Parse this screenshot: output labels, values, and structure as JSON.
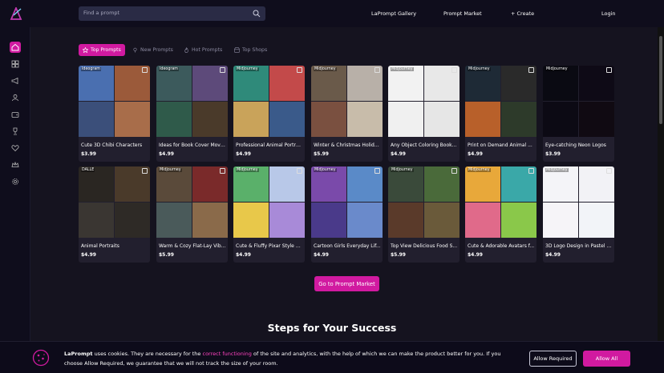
{
  "header": {
    "search_placeholder": "Find a prompt",
    "nav": [
      "LaPrompt Gallery",
      "Prompt Market",
      "+ Create"
    ],
    "login": "Login"
  },
  "sidebar": {
    "items": [
      "home-icon",
      "grid-icon",
      "megaphone-icon",
      "user-icon",
      "wallet-icon",
      "trophy-icon",
      "heart-icon",
      "crown-icon",
      "gear-icon"
    ],
    "active": "home-icon"
  },
  "tabs": [
    {
      "label": "Top Prompts",
      "icon": "star-icon",
      "active": true
    },
    {
      "label": "New Prompts",
      "icon": "pin-icon",
      "active": false
    },
    {
      "label": "Hot Prompts",
      "icon": "flame-icon",
      "active": false
    },
    {
      "label": "Top Shops",
      "icon": "shop-icon",
      "active": false
    }
  ],
  "cards": [
    {
      "badge": "Ideogram",
      "title": "Cute 3D Chibi Characters",
      "price": "$3.99",
      "colors": [
        "#4a6fb0",
        "#9b5a3a",
        "#3b4f7a",
        "#a86d4a"
      ]
    },
    {
      "badge": "Ideogram",
      "title": "Ideas for Book Cover Movi...",
      "price": "$4.99",
      "colors": [
        "#3c5a5c",
        "#5d4a7a",
        "#2f5a4a",
        "#4a3a2a"
      ]
    },
    {
      "badge": "Midjourney",
      "title": "Professional Animal Portra...",
      "price": "$4.99",
      "colors": [
        "#2f8a7a",
        "#c34a4a",
        "#c9a35a",
        "#3a5a8a"
      ]
    },
    {
      "badge": "Midjourney",
      "title": "Winter & Christmas Holida...",
      "price": "$5.99",
      "colors": [
        "#6a5a4a",
        "#b8b0a8",
        "#7a5040",
        "#c8bcaa"
      ]
    },
    {
      "badge": "Midjourney",
      "title": "Any Object Coloring Book ...",
      "price": "$4.99",
      "colors": [
        "#f2f2f2",
        "#e8e8e8",
        "#f0f0f0",
        "#e6e6e6"
      ]
    },
    {
      "badge": "Midjourney",
      "title": "Print on Demand Animal ...",
      "price": "$4.99",
      "colors": [
        "#1e2a36",
        "#2a2a2a",
        "#b8602a",
        "#2d3a2a"
      ]
    },
    {
      "badge": "Midjourney",
      "title": "Eye-catching Neon Logos",
      "price": "$3.99",
      "colors": [
        "#0a0a12",
        "#0e0a16",
        "#0c0a14",
        "#100a12"
      ]
    },
    {
      "badge": "DALLE",
      "title": "Animal Portraits",
      "price": "$4.99",
      "colors": [
        "#2a2622",
        "#4a3a2a",
        "#3a3632",
        "#2e2a26"
      ]
    },
    {
      "badge": "Midjourney",
      "title": "Warm & Cozy Flat-Lay Vib...",
      "price": "$5.99",
      "colors": [
        "#5a4a3a",
        "#7a2a2a",
        "#4a5a5a",
        "#8a6a4a"
      ]
    },
    {
      "badge": "Midjourney",
      "title": "Cute & Fluffy Pixar Style A...",
      "price": "$4.99",
      "colors": [
        "#5ab06a",
        "#b8c8e8",
        "#e8c84a",
        "#a88ad8"
      ]
    },
    {
      "badge": "Midjourney",
      "title": "Cartoon Girls Everyday Lif...",
      "price": "$4.99",
      "colors": [
        "#7a4aaa",
        "#5a8ac8",
        "#4a3a8a",
        "#6a8acb"
      ]
    },
    {
      "badge": "Midjourney",
      "title": "Top View Delicious Food S...",
      "price": "$5.99",
      "colors": [
        "#3a4a3a",
        "#4a6a3a",
        "#5a3a2a",
        "#6a5a3a"
      ]
    },
    {
      "badge": "Midjourney",
      "title": "Cute & Adorable Avatars f...",
      "price": "$4.99",
      "colors": [
        "#e8a83a",
        "#3aa8a8",
        "#e06a8a",
        "#8ac84a"
      ]
    },
    {
      "badge": "Midjourney",
      "title": "3D Logo Design in Pastel C...",
      "price": "$4.99",
      "colors": [
        "#f4f4f8",
        "#f2f2f6",
        "#f6f4f8",
        "#f2f4f8"
      ]
    }
  ],
  "cta": "Go to Prompt Market",
  "steps_heading": "Steps for Your Success",
  "cookie": {
    "brand": "LaPrompt",
    "text1": " uses cookies. They are necessary for the ",
    "link": "correct functioning",
    "text2": " of the site and analytics, with the help of which we can make the product better for you. If you choose Allow Required, we guarantee that we will not track the size of your room.",
    "allow_required": "Allow Required",
    "allow_all": "Allow All"
  },
  "colors": {
    "accent": "#d11aa0",
    "bg": "#15131f",
    "card": "#221f2e"
  }
}
